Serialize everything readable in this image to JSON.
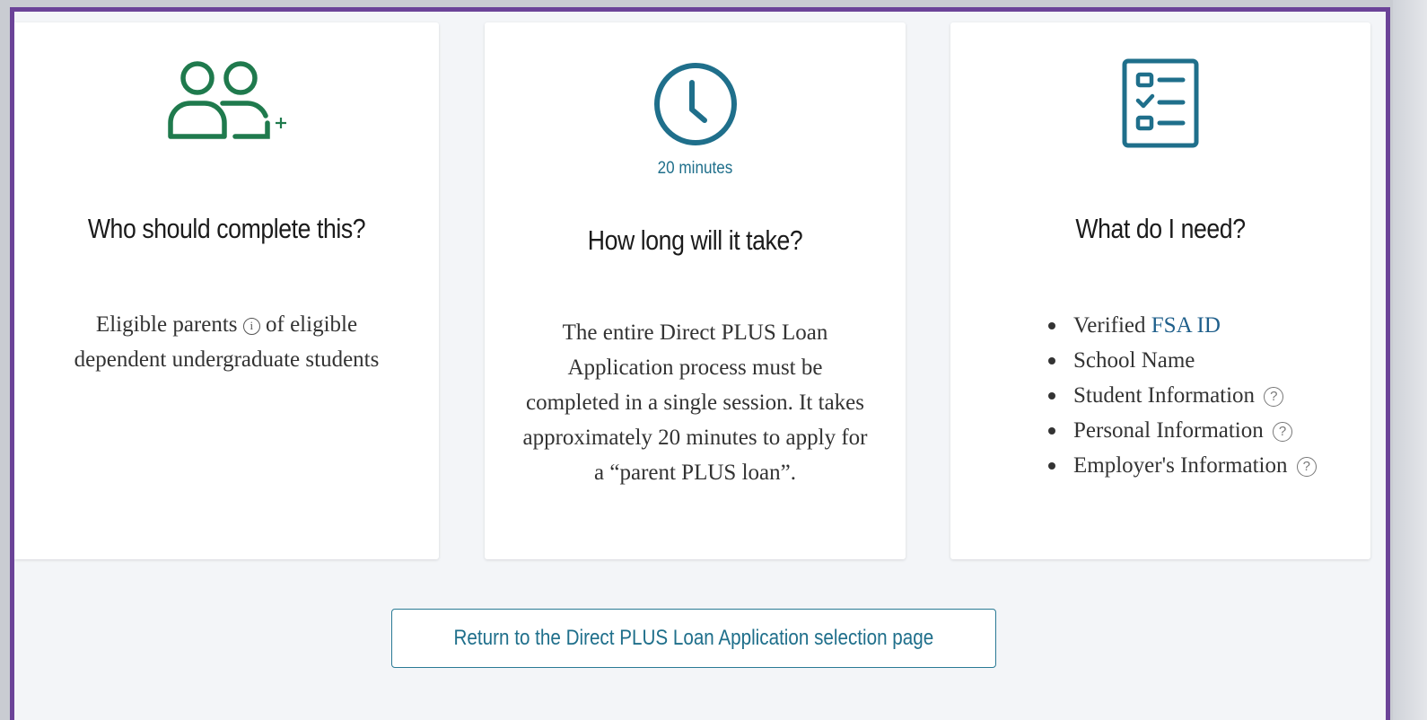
{
  "cards": {
    "who": {
      "icon": "people-add-icon",
      "title": "Who should complete this?",
      "body_before": "Eligible parents",
      "info_glyph": "i",
      "body_after": "of eligible dependent undergraduate students"
    },
    "time": {
      "icon": "clock-icon",
      "time_label": "20 minutes",
      "title": "How long will it take?",
      "body": "The entire Direct PLUS Loan Application process must be completed in a single session. It takes approximately 20 minutes to apply for a “parent PLUS loan”."
    },
    "needs": {
      "icon": "checklist-icon",
      "title": "What do I need?",
      "items": [
        {
          "prefix": "Verified ",
          "link": "FSA ID",
          "help": ""
        },
        {
          "prefix": "School Name",
          "link": "",
          "help": ""
        },
        {
          "prefix": "Student Information",
          "link": "",
          "help": "?"
        },
        {
          "prefix": "Personal Information",
          "link": "",
          "help": "?"
        },
        {
          "prefix": "Employer's Information",
          "link": "",
          "help": "?"
        }
      ]
    }
  },
  "return_button": {
    "label": "Return to the Direct PLUS Loan Application selection page"
  },
  "colors": {
    "frame_border": "#6b4398",
    "green_icon": "#1f7a4d",
    "blue_accent": "#1f6f8b",
    "page_bg": "#f3f5f8"
  }
}
